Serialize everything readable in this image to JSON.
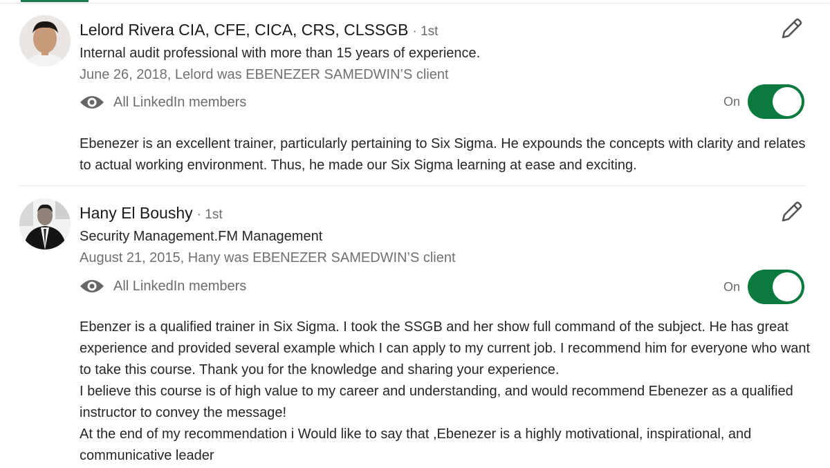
{
  "recommendations": [
    {
      "name": "Lelord Rivera CIA, CFE, CICA, CRS, CLSSGB",
      "degree": "· 1st",
      "headline": "Internal audit professional with more than 15 years of experience.",
      "relation": "June 26, 2018, Lelord was EBENEZER SAMEDWIN’S client",
      "visibility": "All LinkedIn members",
      "toggle_label": "On",
      "toggle_on": true,
      "icons": {
        "visibility": "eye-icon",
        "edit": "pencil-icon"
      },
      "text": [
        "Ebenezer is an excellent trainer, particularly pertaining to Six Sigma. He expounds the concepts with clarity and relates to actual working environment. Thus, he made our Six Sigma learning at ease and exciting."
      ]
    },
    {
      "name": "Hany El Boushy",
      "degree": "· 1st",
      "headline": "Security Management.FM Management",
      "relation": "August 21, 2015, Hany was EBENEZER SAMEDWIN’S client",
      "visibility": "All LinkedIn members",
      "toggle_label": "On",
      "toggle_on": true,
      "icons": {
        "visibility": "eye-icon",
        "edit": "pencil-icon"
      },
      "text": [
        "Ebenzer is a qualified trainer in Six Sigma. I took the SSGB and her show full command of the subject. He has great experience and provided several example which I can apply to my current job. I recommend him for everyone who want to take this course. Thank you for the knowledge and sharing your experience.",
        "I believe this course is of high value to my career and understanding, and would recommend Ebenezer as a qualified instructor to convey the message!",
        "At the end of my recommendation i Would like to say that ,Ebenezer is a highly motivational, inspirational, and communicative leader"
      ]
    }
  ],
  "colors": {
    "accent_green": "#0b7a3e",
    "muted_text": "#6b6b6b"
  }
}
